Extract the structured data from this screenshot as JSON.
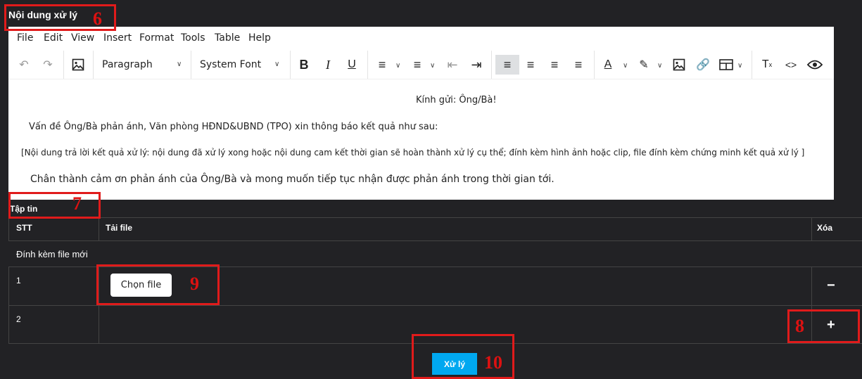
{
  "panel": {
    "title": "Nội dung xử lý"
  },
  "menu": [
    "File",
    "Edit",
    "View",
    "Insert",
    "Format",
    "Tools",
    "Table",
    "Help"
  ],
  "toolbar": {
    "block_format": "Paragraph",
    "font_family": "System Font"
  },
  "editor": {
    "greeting": "Kính gửi: Ông/Bà!",
    "line1": "Vấn đề Ông/Bà phản ánh, Văn phòng HĐND&UBND (TPO) xin thông báo kết quả như sau:",
    "line2": "[Nội dung trả lời kết quả xử lý: nội dung đã xử lý xong hoặc nội dung cam kết thời gian sẽ hoàn thành xử lý cụ thể; đính kèm hình ảnh hoặc clip, file đính kèm chứng minh kết quả xử lý ]",
    "line3": "Chân thành cảm ơn phản ánh của Ông/Bà và mong muốn tiếp tục nhận được phản ánh trong thời gian tới."
  },
  "files": {
    "label": "Tập tin",
    "columns": {
      "stt": "STT",
      "upload": "Tải file",
      "delete": "Xóa"
    },
    "attach_new": "Đính kèm file mới",
    "rows": [
      {
        "stt": "1",
        "choose_label": "Chọn file",
        "action": "−"
      },
      {
        "stt": "2",
        "action": "+"
      }
    ]
  },
  "submit_label": "Xử lý",
  "annotations": [
    "6",
    "7",
    "8",
    "9",
    "10"
  ],
  "colors": {
    "accent": "#00a8f0",
    "annotation": "#e01b1b",
    "background": "#222225"
  }
}
